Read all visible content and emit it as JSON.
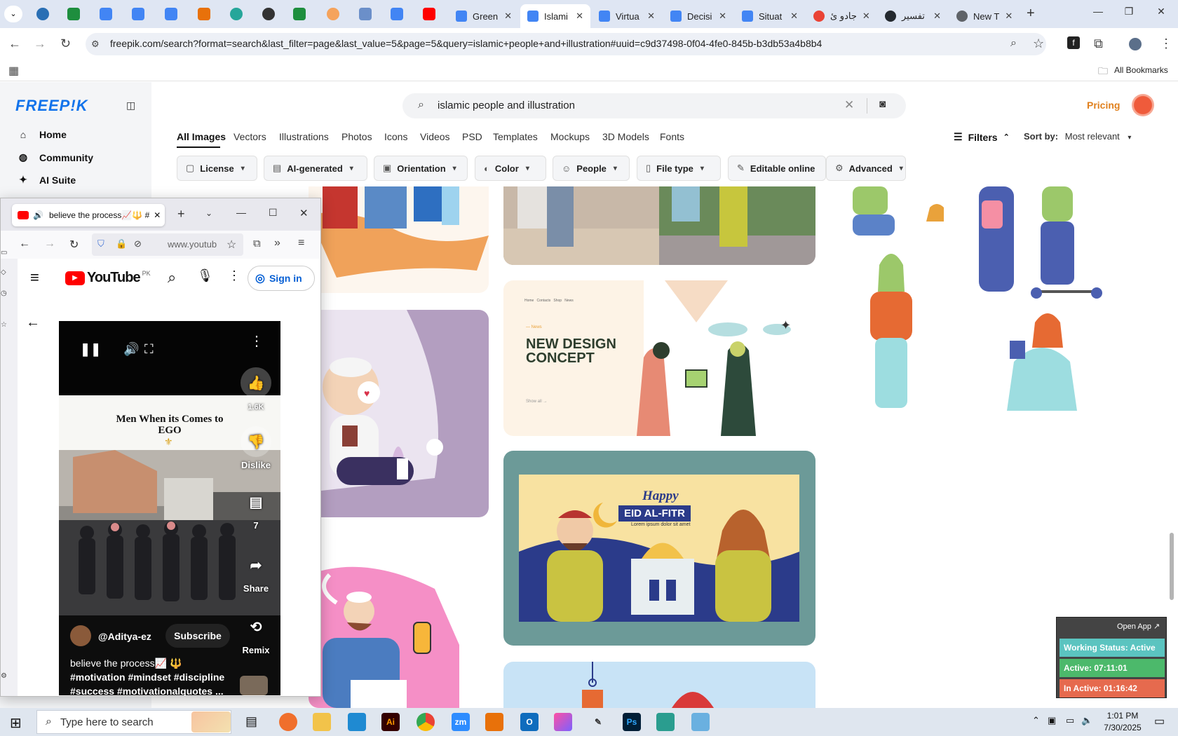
{
  "browser": {
    "tabs": [
      {
        "label": "Green",
        "color": "#1a73e8"
      },
      {
        "label": "Islami",
        "color": "#1a73e8"
      },
      {
        "label": "Virtua",
        "color": "#1a73e8"
      },
      {
        "label": "Decisi",
        "color": "#1a73e8"
      },
      {
        "label": "Situat",
        "color": "#1a73e8"
      },
      {
        "label": "جادو ئ",
        "color": "#ea4335"
      },
      {
        "label": "تفسير",
        "color": "#24292f"
      },
      {
        "label": "New T",
        "color": "#5f6368"
      }
    ],
    "url": "freepik.com/search?format=search&last_filter=page&last_value=5&page=5&query=islamic+people+and+illustration#uuid=c9d37498-0f04-4fe0-845b-b3db53a4b8b4",
    "all_bookmarks": "All Bookmarks"
  },
  "freepik": {
    "logo": "FREEP!K",
    "nav": {
      "home": "Home",
      "community": "Community",
      "ai_suite": "AI Suite"
    },
    "search_value": "islamic people and illustration",
    "pricing": "Pricing",
    "categories": [
      "All Images",
      "Vectors",
      "Illustrations",
      "Photos",
      "Icons",
      "Videos",
      "PSD",
      "Templates",
      "Mockups",
      "3D Models",
      "Fonts"
    ],
    "filters_label": "Filters",
    "sort_label": "Sort by:",
    "sort_value": "Most relevant",
    "filter_buttons": [
      "License",
      "AI-generated",
      "Orientation",
      "Color",
      "People",
      "File type",
      "Editable online",
      "Advanced"
    ],
    "card_texts": {
      "design_title_1": "NEW DESIGN",
      "design_title_2": "CONCEPT",
      "design_tag": "— News",
      "design_nav": "Home   Contacts   Shop   News",
      "design_more": "Show all  →",
      "eid_happy": "Happy",
      "eid_title": "EID AL-FITR",
      "eid_sub": "Lorem ipsum dolor sit amet"
    }
  },
  "youtube": {
    "tab_title": "believe the process📈🔱 #",
    "url": "www.youtub",
    "logo": "YouTube",
    "region": "PK",
    "sign_in": "Sign in",
    "caption_line1": "Men When its Comes to",
    "caption_line2": "EGO",
    "like_count": "1.6K",
    "dislike": "Dislike",
    "comments": "7",
    "share": "Share",
    "remix": "Remix",
    "channel": "@Aditya-ez",
    "subscribe": "Subscribe",
    "title": "believe the process📈 🔱",
    "hashtags1": "#motivation #mindset #discipline",
    "hashtags2": "#success #motivationalquotes ..."
  },
  "work_status": {
    "open_app": "Open App ↗",
    "status": "Working Status: Active",
    "active": "Active: 07:11:01",
    "inactive": "In Active: 01:16:42",
    "colors": {
      "status": "#5bc4c0",
      "active": "#4cb96b",
      "inactive": "#e66a4e"
    }
  },
  "taskbar": {
    "search_placeholder": "Type here to search",
    "time": "1:01 PM",
    "date": "7/30/2025"
  }
}
